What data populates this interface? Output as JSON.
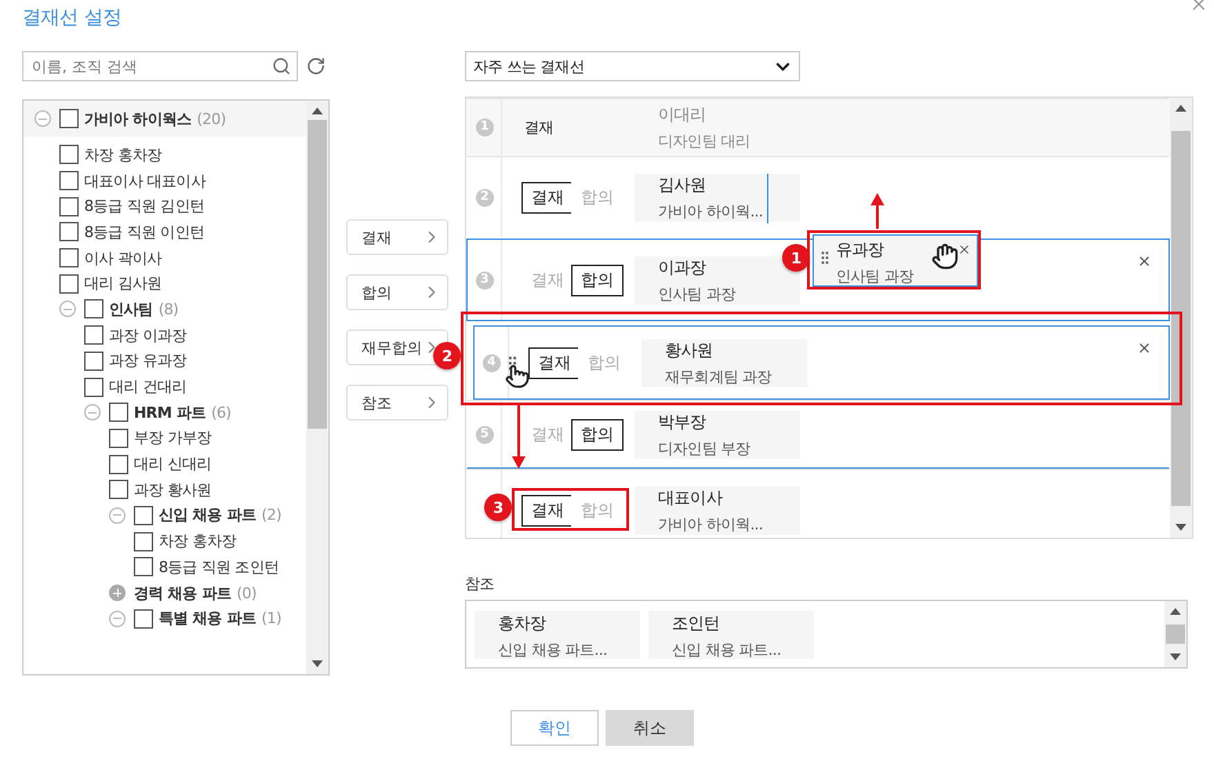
{
  "title": "결재선 설정",
  "search": {
    "placeholder": "이름, 조직 검색"
  },
  "tree": [
    {
      "kind": "group",
      "label": "가비아 하이웍스",
      "count": "(20)",
      "expanded": true,
      "checked": false,
      "children": [
        {
          "kind": "person",
          "label": "차장 홍차장",
          "checked": false
        },
        {
          "kind": "person",
          "label": "대표이사 대표이사",
          "checked": false
        },
        {
          "kind": "person",
          "label": "8등급 직원 김인턴",
          "checked": false
        },
        {
          "kind": "person",
          "label": "8등급 직원 이인턴",
          "checked": false
        },
        {
          "kind": "person",
          "label": "이사 곽이사",
          "checked": false
        },
        {
          "kind": "person",
          "label": "대리 김사원",
          "checked": false
        },
        {
          "kind": "group",
          "label": "인사팀",
          "count": "(8)",
          "expanded": true,
          "checked": false,
          "children": [
            {
              "kind": "person",
              "label": "과장 이과장",
              "checked": false
            },
            {
              "kind": "person",
              "label": "과장 유과장",
              "checked": false
            },
            {
              "kind": "person",
              "label": "대리 건대리",
              "checked": false
            },
            {
              "kind": "group",
              "label": "HRM 파트",
              "count": "(6)",
              "expanded": true,
              "checked": false,
              "children": [
                {
                  "kind": "person",
                  "label": "부장 가부장",
                  "checked": false
                },
                {
                  "kind": "person",
                  "label": "대리 신대리",
                  "checked": false
                },
                {
                  "kind": "person",
                  "label": "과장 황사원",
                  "checked": false
                },
                {
                  "kind": "group",
                  "label": "신입 채용 파트",
                  "count": "(2)",
                  "expanded": true,
                  "checked": false,
                  "children": [
                    {
                      "kind": "person",
                      "label": "차장 홍차장",
                      "checked": false
                    },
                    {
                      "kind": "person",
                      "label": "8등급 직원 조인턴",
                      "checked": false
                    }
                  ]
                },
                {
                  "kind": "group",
                  "label": "경력 채용 파트",
                  "count": "(0)",
                  "expanded": false
                },
                {
                  "kind": "group",
                  "label": "특별 채용 파트",
                  "count": "(1)",
                  "expanded": true,
                  "checked": false
                }
              ]
            }
          ]
        }
      ]
    }
  ],
  "add_buttons": [
    "결재",
    "합의",
    "재무합의",
    "참조"
  ],
  "line_select": {
    "value": "자주 쓰는 결재선"
  },
  "approval_rows": [
    {
      "number": "1",
      "kind": "fixed",
      "type": "결재",
      "name": "이대리",
      "dept": "디자인팀 대리"
    },
    {
      "number": "2",
      "kind": "toggle",
      "options": [
        {
          "label": "결재",
          "selected": true
        },
        {
          "label": "합의",
          "selected": false
        }
      ],
      "name": "김사원",
      "dept": "가비아 하이웍...",
      "highlighted": false,
      "removable": false,
      "drop_target": true
    },
    {
      "number": "3",
      "kind": "toggle",
      "options": [
        {
          "label": "결재",
          "selected": false
        },
        {
          "label": "합의",
          "selected": true
        }
      ],
      "name": "이과장",
      "dept": "인사팀 과장",
      "highlighted": true,
      "removable": true
    },
    {
      "number": "4",
      "kind": "toggle",
      "options": [
        {
          "label": "결재",
          "selected": true
        },
        {
          "label": "합의",
          "selected": false
        }
      ],
      "name": "황사원",
      "dept": "재무회계팀 과장",
      "highlighted": true,
      "removable": true,
      "dragging": true
    },
    {
      "number": "5",
      "kind": "toggle",
      "options": [
        {
          "label": "결재",
          "selected": false
        },
        {
          "label": "합의",
          "selected": true
        }
      ],
      "name": "박부장",
      "dept": "디자인팀 부장",
      "highlighted": false,
      "removable": false,
      "drop_line_below": true
    },
    {
      "kind": "toggle",
      "options": [
        {
          "label": "결재",
          "selected": true
        },
        {
          "label": "합의",
          "selected": false
        }
      ],
      "name": "대표이사",
      "dept": "가비아 하이웍...",
      "highlighted": false,
      "removable": false
    }
  ],
  "drag_card": {
    "name": "유과장",
    "dept": "인사팀 과장"
  },
  "reference": {
    "label": "참조",
    "items": [
      {
        "name": "홍차장",
        "dept": "신입 채용 파트..."
      },
      {
        "name": "조인턴",
        "dept": "신입 채용 파트..."
      }
    ]
  },
  "buttons": [
    {
      "label": "확인",
      "kind": "primary"
    },
    {
      "label": "취소",
      "kind": "secondary"
    }
  ],
  "annotations": [
    {
      "number": "1"
    },
    {
      "number": "2"
    },
    {
      "number": "3"
    }
  ]
}
